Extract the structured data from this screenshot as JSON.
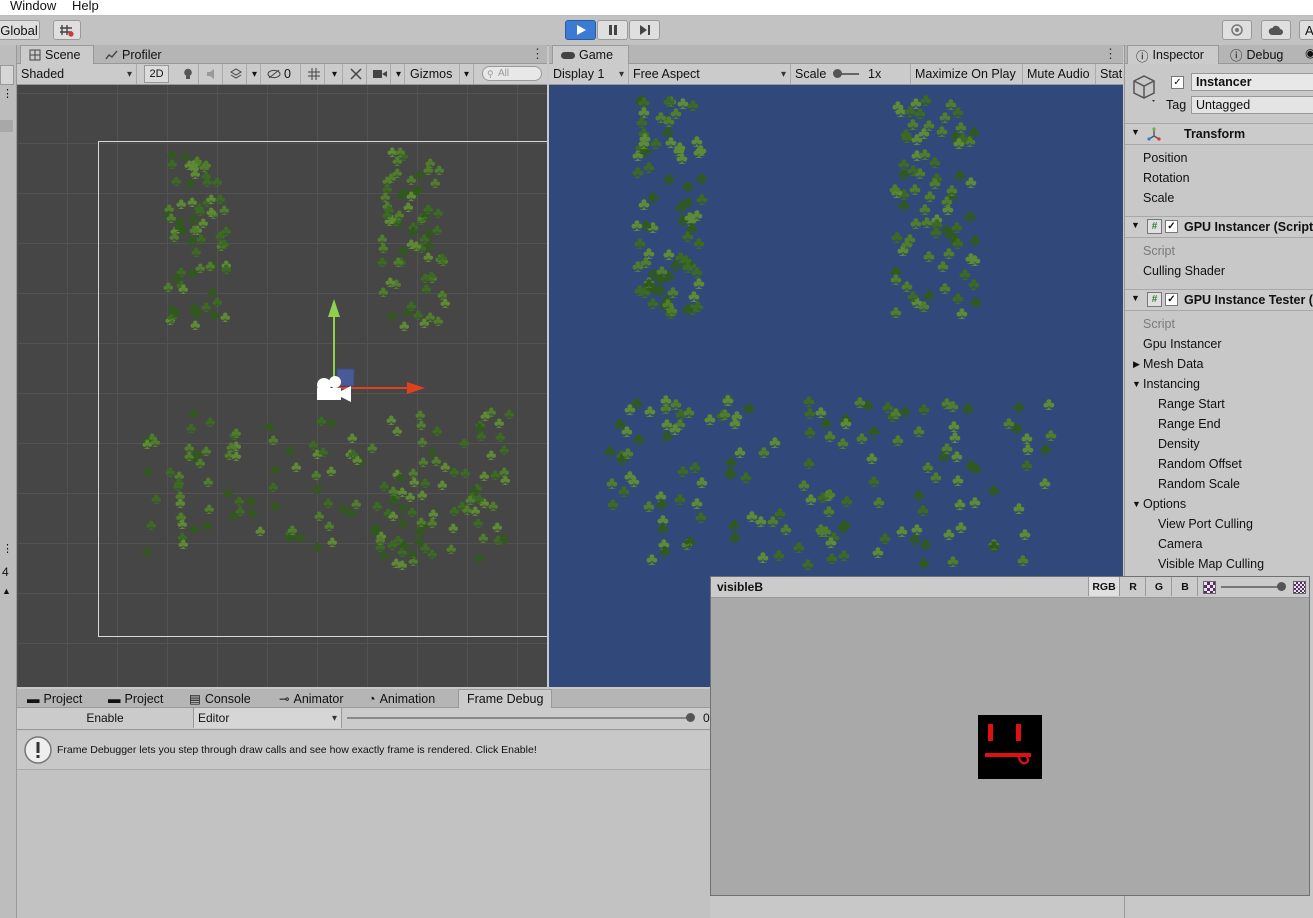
{
  "menu": {
    "items": [
      "Window",
      "Help"
    ]
  },
  "toolbar": {
    "global_label": "Global",
    "play_icon": "play-icon",
    "pause_icon": "pause-icon",
    "step_icon": "step-icon",
    "account_label": "A",
    "accent": "#3c7bd4"
  },
  "scene": {
    "tabs": [
      "Scene",
      "Profiler"
    ],
    "shading": "Shaded",
    "mode_2d": "2D",
    "fx_count": "0",
    "gizmos": "Gizmos",
    "search_placeholder": "All",
    "bg_color": "#464646"
  },
  "game": {
    "tab": "Game",
    "display": "Display 1",
    "aspect": "Free Aspect",
    "scale_label": "Scale",
    "scale_value": "1x",
    "maximize": "Maximize On Play",
    "mute": "Mute Audio",
    "stats": "Stat",
    "bg_color": "#31497a"
  },
  "inspector": {
    "tabs": [
      "Inspector",
      "Debug"
    ],
    "object_name": "Instancer",
    "tag_label": "Tag",
    "tag_value": "Untagged",
    "transform": {
      "title": "Transform",
      "props": [
        "Position",
        "Rotation",
        "Scale"
      ]
    },
    "gpu_instancer": {
      "title": "GPU Instancer (Script",
      "props": [
        "Script",
        "Culling Shader"
      ]
    },
    "gpu_tester": {
      "title": "GPU Instance Tester (",
      "props": [
        "Script",
        "Gpu Instancer"
      ],
      "mesh_data": "Mesh Data",
      "instancing": "Instancing",
      "instancing_props": [
        "Range Start",
        "Range End",
        "Density",
        "Random Offset",
        "Random Scale"
      ],
      "options": "Options",
      "options_props": [
        "View Port Culling",
        "Camera",
        "Visible Map Culling"
      ]
    }
  },
  "bottom": {
    "tabs": [
      "Project",
      "Project",
      "Console",
      "Animator",
      "Animation",
      "Frame Debug"
    ],
    "enable": "Enable",
    "editor": "Editor",
    "slider_value": "0",
    "info": "Frame Debugger lets you step through draw calls and see how exactly frame is rendered. Click Enable!"
  },
  "left_strip": {
    "number": "4"
  },
  "visible_window": {
    "title": "visibleB",
    "channels": [
      "RGB",
      "R",
      "G",
      "B"
    ],
    "bg_color": "#a9a9a9",
    "texture_color": "#e01010"
  }
}
